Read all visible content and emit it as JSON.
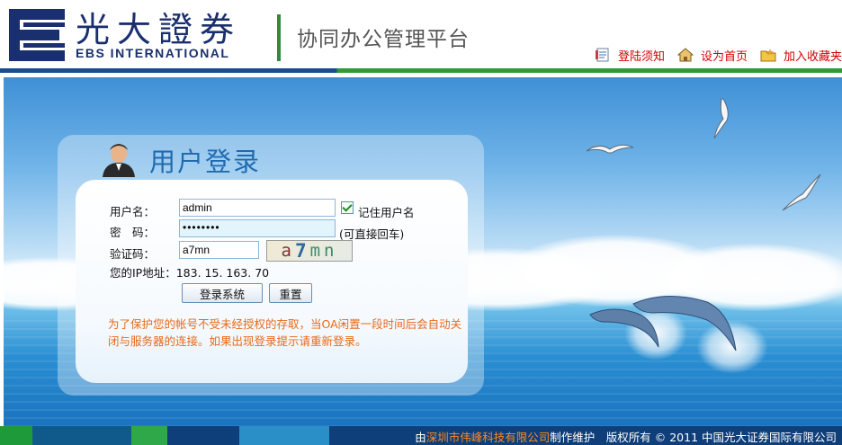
{
  "header": {
    "logo_cn": "光大證券",
    "logo_en": "EBS INTERNATIONAL",
    "platform_title": "协同办公管理平台",
    "links": [
      {
        "label": "登陆须知",
        "icon": "notice-document-icon"
      },
      {
        "label": "设为首页",
        "icon": "home-icon"
      },
      {
        "label": "加入收藏夹",
        "icon": "favorites-folder-icon"
      }
    ]
  },
  "login": {
    "title": "用户登录",
    "username_label": "用户名：",
    "username_value": "admin",
    "remember_label": "记住用户名",
    "remember_checked": true,
    "password_label": "密　码：",
    "password_value": "••••••••",
    "password_hint": "(可直接回车)",
    "captcha_label": "验证码：",
    "captcha_value": "a7mn",
    "captcha_image_chars": [
      "a",
      "7",
      "mn"
    ],
    "ip_label": "您的IP地址：",
    "ip_value": "183. 15. 163. 70",
    "submit_label": "登录系统",
    "reset_label": "重置",
    "notice": "为了保护您的帐号不受未经授权的存取，当OA闲置一段时间后会自动关闭与服务器的连接。如果出现登录提示请重新登录。"
  },
  "footer": {
    "prefix": "由",
    "org": "深圳市伟峰科技有限公司",
    "suffix": "制作维护　版权所有 © 2011  中国光大证券国际有限公司"
  },
  "colors": {
    "brand_blue": "#1a2f6e",
    "accent_green": "#2f8a3a",
    "link_red": "#d40000",
    "notice_orange": "#e86a1a",
    "title_blue": "#1f6bb0",
    "footer_blue": "#0f3f7a"
  }
}
